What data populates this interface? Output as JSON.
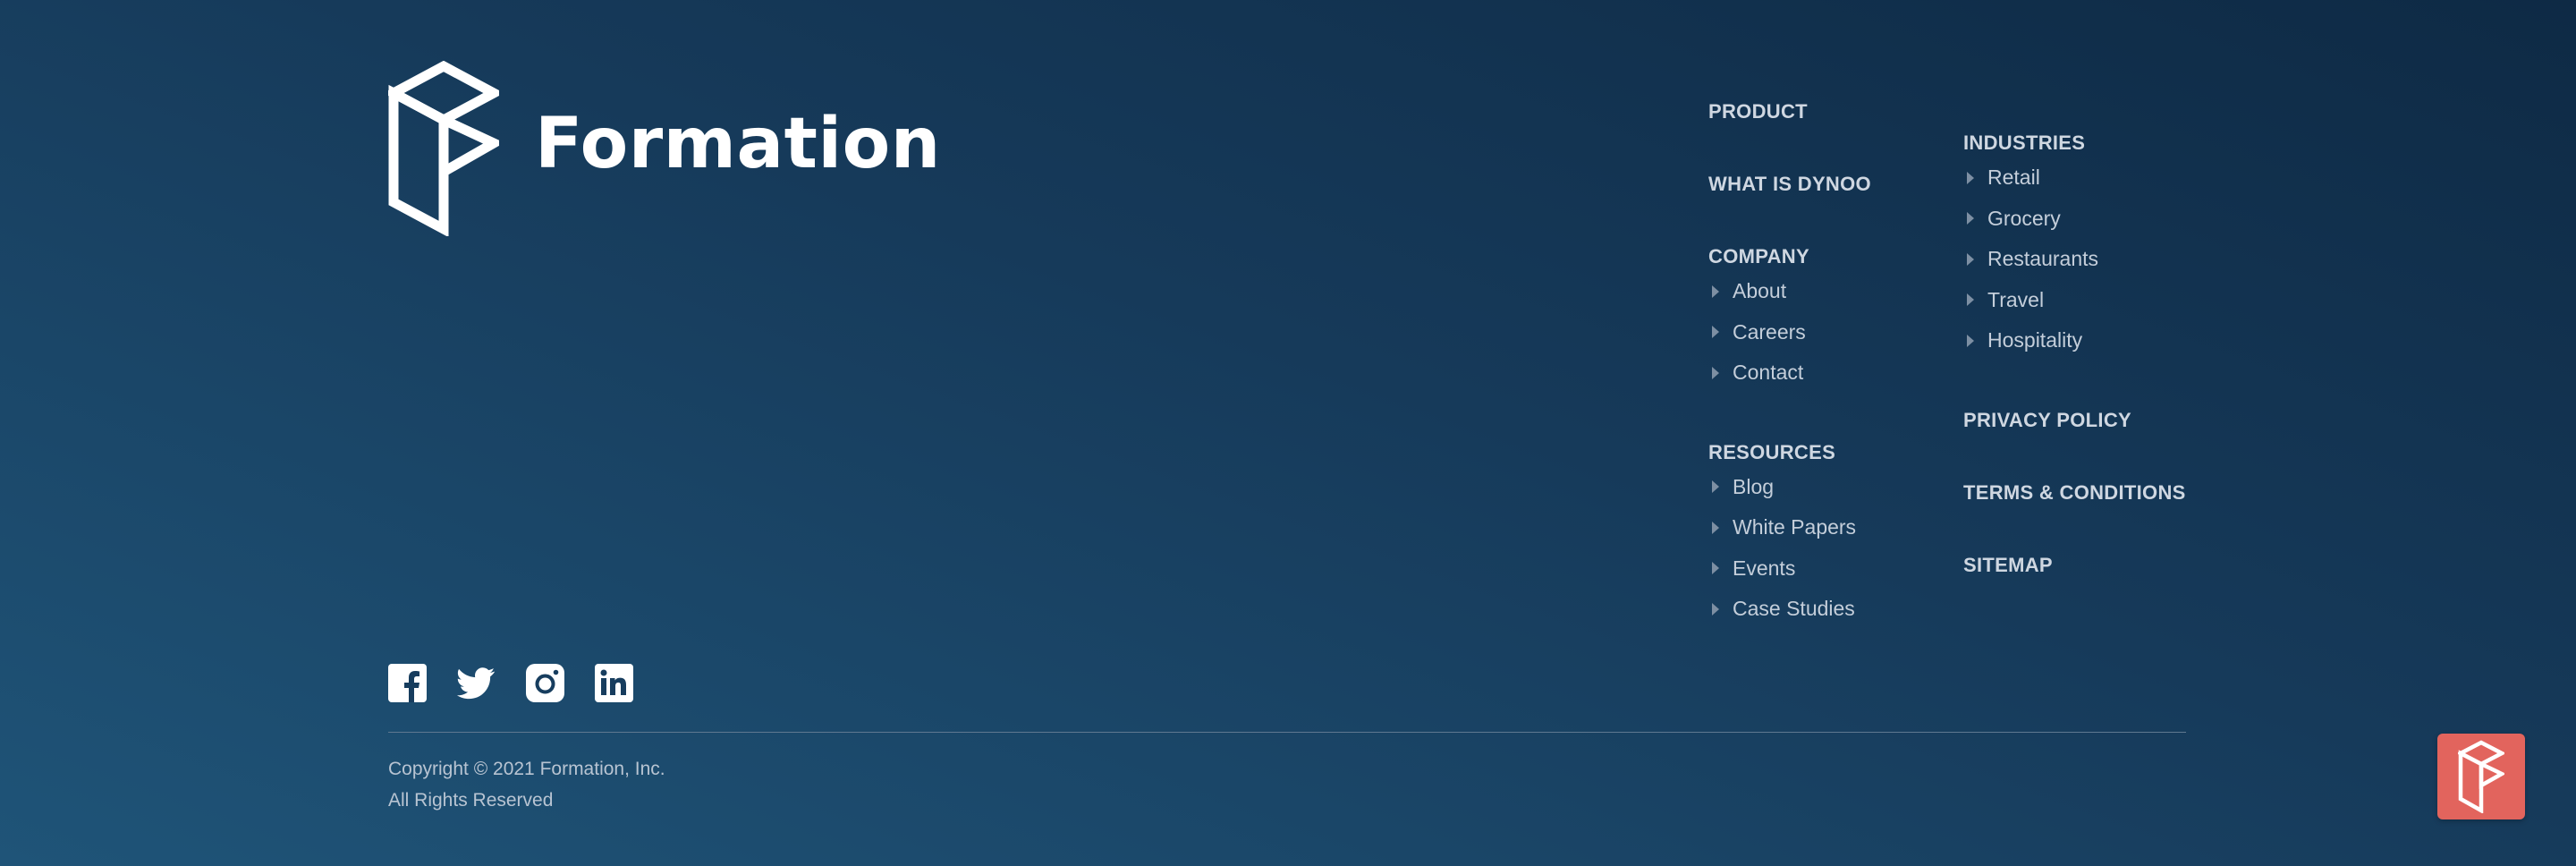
{
  "brand": {
    "name": "Formation"
  },
  "nav": {
    "col1": [
      {
        "heading": "PRODUCT",
        "items": []
      },
      {
        "heading": "WHAT IS DYNOO",
        "items": []
      },
      {
        "heading": "COMPANY",
        "items": [
          "About",
          "Careers",
          "Contact"
        ]
      },
      {
        "heading": "RESOURCES",
        "items": [
          "Blog",
          "White Papers",
          "Events",
          "Case Studies"
        ]
      }
    ],
    "col2": [
      {
        "heading": "INDUSTRIES",
        "items": [
          "Retail",
          "Grocery",
          "Restaurants",
          "Travel",
          "Hospitality"
        ]
      },
      {
        "heading": "PRIVACY POLICY",
        "items": []
      },
      {
        "heading": "TERMS & CONDITIONS",
        "items": []
      },
      {
        "heading": "SITEMAP",
        "items": []
      }
    ]
  },
  "social": [
    "facebook-icon",
    "twitter-icon",
    "instagram-icon",
    "linkedin-icon"
  ],
  "footer": {
    "copyright": "Copyright © 2021 Formation, Inc.",
    "rights": "All Rights Reserved"
  },
  "colors": {
    "background_dark": "#0e2a45",
    "background_light": "#1f5478",
    "accent": "#e2645d"
  }
}
